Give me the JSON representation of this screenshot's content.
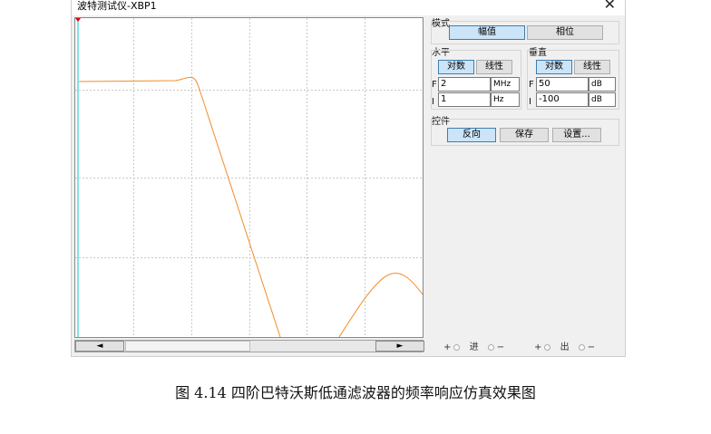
{
  "window": {
    "title": "波特测试仪-XBP1",
    "close_glyph": "✕"
  },
  "scroll": {
    "left_glyph": "◄",
    "right_glyph": "►"
  },
  "mode": {
    "label": "模式",
    "magnitude": "幅值",
    "phase": "相位",
    "selected": "magnitude"
  },
  "horizontal": {
    "label": "水平",
    "log": "对数",
    "linear": "线性",
    "selected": "log",
    "final_label": "F",
    "final_value": "2",
    "final_unit": "MHz",
    "initial_label": "I",
    "initial_value": "1",
    "initial_unit": "Hz"
  },
  "vertical": {
    "label": "垂直",
    "log": "对数",
    "linear": "线性",
    "selected": "log",
    "final_label": "F",
    "final_value": "50",
    "final_unit": "dB",
    "initial_label": "I",
    "initial_value": "-100",
    "initial_unit": "dB"
  },
  "controls": {
    "label": "控件",
    "reverse": "反向",
    "save": "保存",
    "settings": "设置..."
  },
  "terminals": {
    "plus": "+",
    "minus": "−",
    "in": "进",
    "out": "出"
  },
  "colors": {
    "trace": "#f28c28",
    "cursor": "#00c8c8",
    "grid": "#c8c8c8"
  },
  "caption": "图 4.14 四阶巴特沃斯低通滤波器的频率响应仿真效果图"
}
